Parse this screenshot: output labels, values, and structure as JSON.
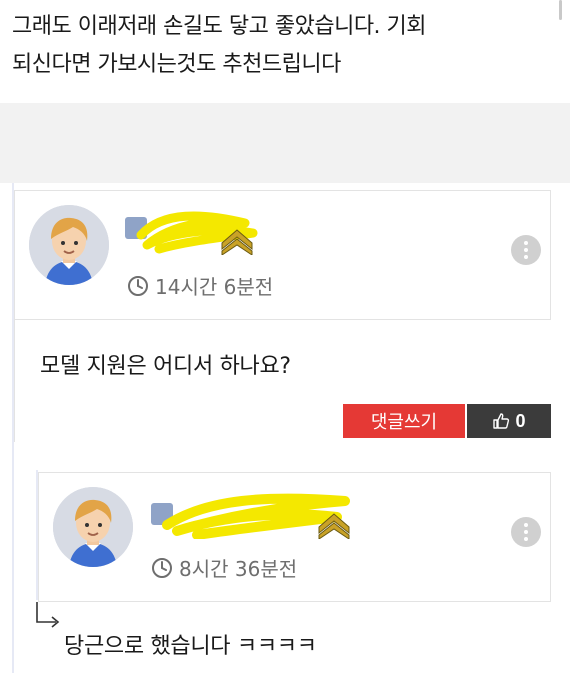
{
  "post": {
    "text_line1": "그래도 이래저래 손길도 닿고 좋았습니다. 기회",
    "text_line2": "되신다면 가보시는것도 추천드립니다"
  },
  "comments": [
    {
      "nickname": "",
      "time": "14시간 6분전",
      "text": "모델 지원은 어디서 하나요?",
      "reply_label": "댓글쓰기",
      "like_count": "0"
    },
    {
      "nickname": "",
      "time": "8시간 36분전",
      "text": "당근으로 했습니다 ㅋㅋㅋㅋ"
    }
  ],
  "colors": {
    "reply_button": "#e53935",
    "like_button": "#3b3b3b",
    "redaction_scribble": "#f4e800",
    "rank_chevron": "#c9a227"
  },
  "icons": [
    "clock-icon",
    "more-vertical-icon",
    "thumbs-up-icon",
    "reply-arrow-icon",
    "rank-chevron-icon",
    "level-icon",
    "avatar"
  ]
}
